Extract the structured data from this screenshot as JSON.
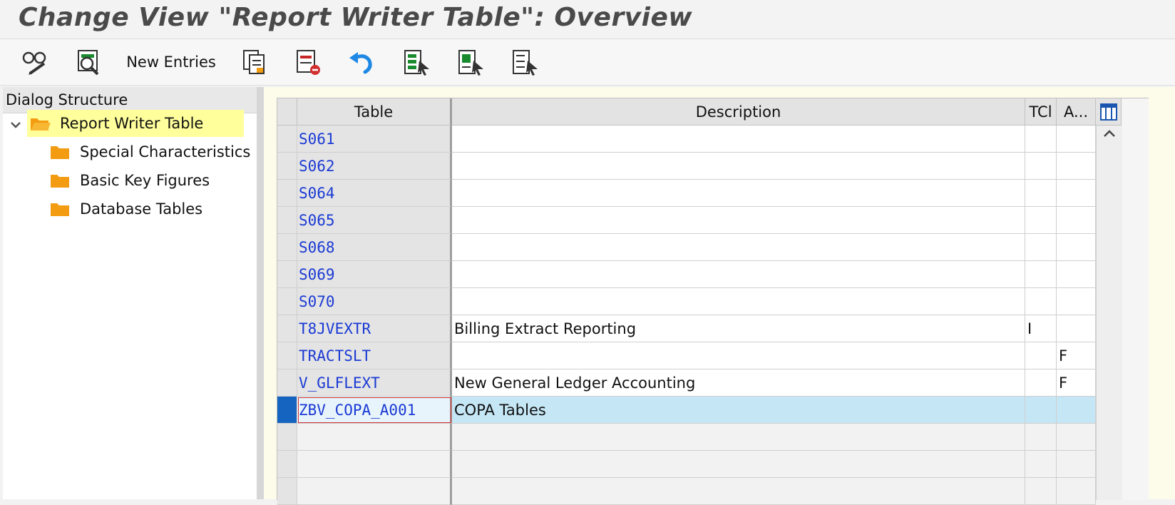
{
  "window": {
    "title": "Change View \"Report Writer Table\": Overview"
  },
  "toolbar": {
    "buttons": [
      {
        "icon": "display-change-icon"
      },
      {
        "icon": "search-details-icon"
      },
      {
        "label": "New Entries"
      },
      {
        "icon": "copy-as-icon"
      },
      {
        "icon": "delete-icon"
      },
      {
        "icon": "undo-icon"
      },
      {
        "icon": "select-all-icon"
      },
      {
        "icon": "select-block-icon"
      },
      {
        "icon": "deselect-all-icon"
      }
    ]
  },
  "dialog_structure": {
    "header": "Dialog Structure",
    "items": [
      {
        "label": "Report Writer Table",
        "selected": true,
        "expanded": true
      },
      {
        "label": "Special Characteristics"
      },
      {
        "label": "Basic Key Figures"
      },
      {
        "label": "Database Tables"
      }
    ]
  },
  "table": {
    "columns": {
      "table": "Table",
      "description": "Description",
      "tcl": "TCl",
      "a": "A..."
    },
    "rows": [
      {
        "table": "S061",
        "description": "",
        "tcl": "",
        "a": ""
      },
      {
        "table": "S062",
        "description": "",
        "tcl": "",
        "a": ""
      },
      {
        "table": "S064",
        "description": "",
        "tcl": "",
        "a": ""
      },
      {
        "table": "S065",
        "description": "",
        "tcl": "",
        "a": ""
      },
      {
        "table": "S068",
        "description": "",
        "tcl": "",
        "a": ""
      },
      {
        "table": "S069",
        "description": "",
        "tcl": "",
        "a": ""
      },
      {
        "table": "S070",
        "description": "",
        "tcl": "",
        "a": ""
      },
      {
        "table": "T8JVEXTR",
        "description": "Billing Extract Reporting",
        "tcl": "I",
        "a": ""
      },
      {
        "table": "TRACTSLT",
        "description": "",
        "tcl": "",
        "a": "F"
      },
      {
        "table": "V_GLFLEXT",
        "description": "New General Ledger Accounting",
        "tcl": "",
        "a": "F"
      },
      {
        "table": "ZBV_COPA_A001",
        "description": "COPA Tables",
        "tcl": "",
        "a": "",
        "selected": true
      }
    ]
  },
  "colors": {
    "key_text": "#1a3ad4",
    "selected_row": "#c5e6f5",
    "selected_marker": "#1565c0",
    "tree_selected": "#ffff9c",
    "folder": "#f39c12"
  }
}
